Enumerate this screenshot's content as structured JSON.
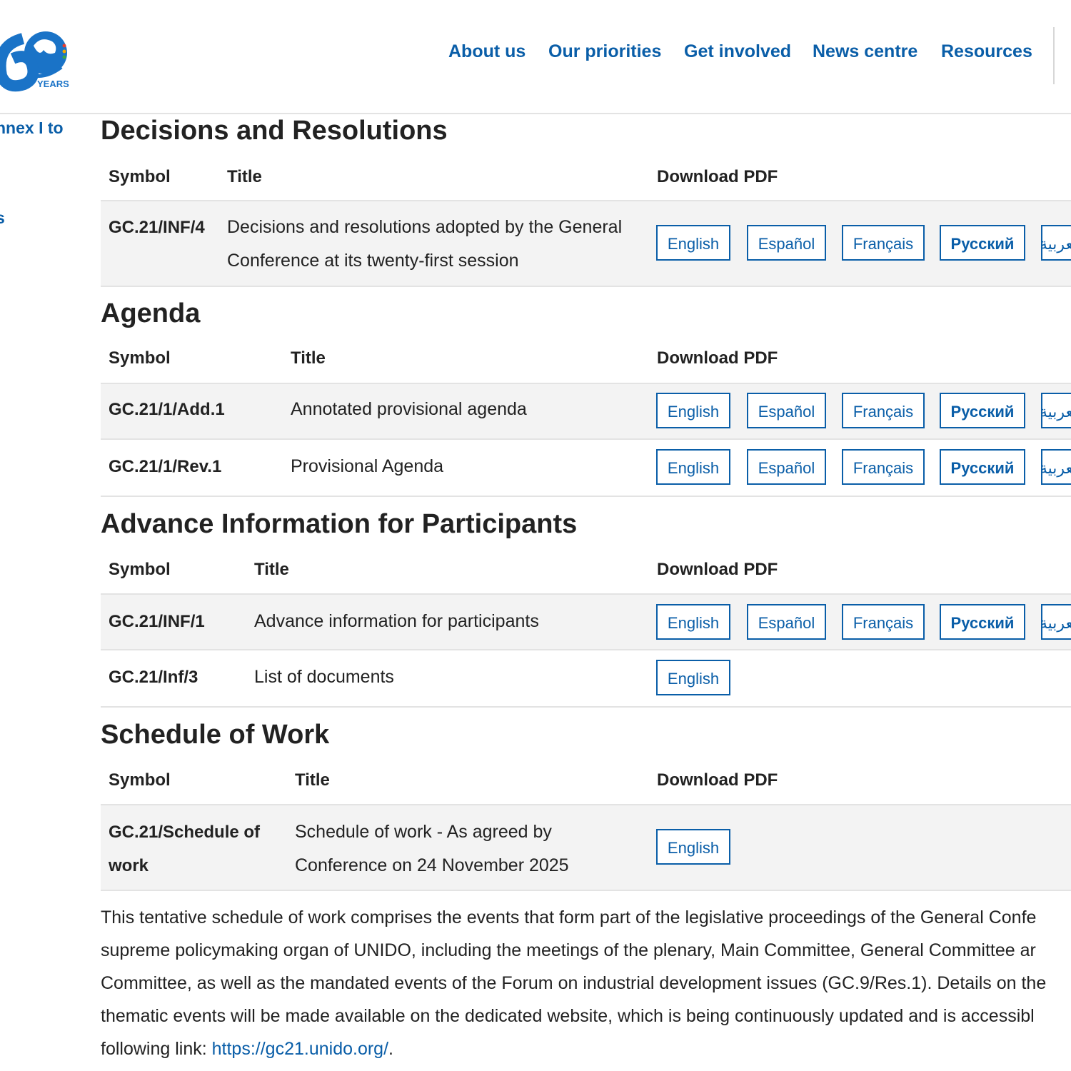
{
  "header": {
    "logo_text": "YEARS",
    "nav": [
      "About us",
      "Our priorities",
      "Get involved",
      "News centre",
      "Resources"
    ]
  },
  "sidebar": {
    "links": [
      "nnex I to",
      "s"
    ]
  },
  "sections": {
    "decisions": {
      "heading": "Decisions and Resolutions",
      "col_symbol": "Symbol",
      "col_title": "Title",
      "col_download": "Download PDF",
      "rows": [
        {
          "symbol": "GC.21/INF/4",
          "title_line1": "Decisions and resolutions adopted by the General",
          "title_line2": "Conference at its twenty-first session"
        }
      ]
    },
    "agenda": {
      "heading": "Agenda",
      "col_symbol": "Symbol",
      "col_title": "Title",
      "col_download": "Download PDF",
      "rows": [
        {
          "symbol": "GC.21/1/Add.1",
          "title": "Annotated provisional agenda"
        },
        {
          "symbol": "GC.21/1/Rev.1",
          "title": "Provisional Agenda"
        }
      ]
    },
    "advance": {
      "heading": "Advance Information for Participants",
      "col_symbol": "Symbol",
      "col_title": "Title",
      "col_download": "Download PDF",
      "rows": [
        {
          "symbol": "GC.21/INF/1",
          "title": "Advance information for participants"
        },
        {
          "symbol": "GC.21/Inf/3",
          "title": "List of documents"
        }
      ]
    },
    "schedule": {
      "heading": "Schedule of Work",
      "col_symbol": "Symbol",
      "col_title": "Title",
      "col_download": "Download PDF",
      "rows": [
        {
          "symbol_line1": "GC.21/Schedule of",
          "symbol_line2": "work",
          "title_line1": "Schedule of work - As agreed by",
          "title_line2": "Conference on 24 November 2025"
        }
      ]
    }
  },
  "languages": {
    "english": "English",
    "espanol": "Español",
    "francais": "Français",
    "russian": "Русский",
    "arabic": "العربية"
  },
  "paragraph": {
    "line1": "This tentative schedule of work comprises the events that form part of the legislative proceedings of the General Confe",
    "line2": "supreme policymaking organ of UNIDO, including the meetings of the plenary, Main Committee, General Committee ar",
    "line3": "Committee, as well as the mandated events of the Forum on industrial development issues (GC.9/Res.1). Details on the",
    "line4": "thematic events will be made available on the dedicated website, which is being continuously updated and is accessibl",
    "line5_prefix": "following link: ",
    "link_text": "https://gc21.unido.org/",
    "line5_suffix": "."
  },
  "colors": {
    "link": "#0a5ea8",
    "row_shade": "#f3f3f3",
    "divider": "#e3e3e3"
  }
}
